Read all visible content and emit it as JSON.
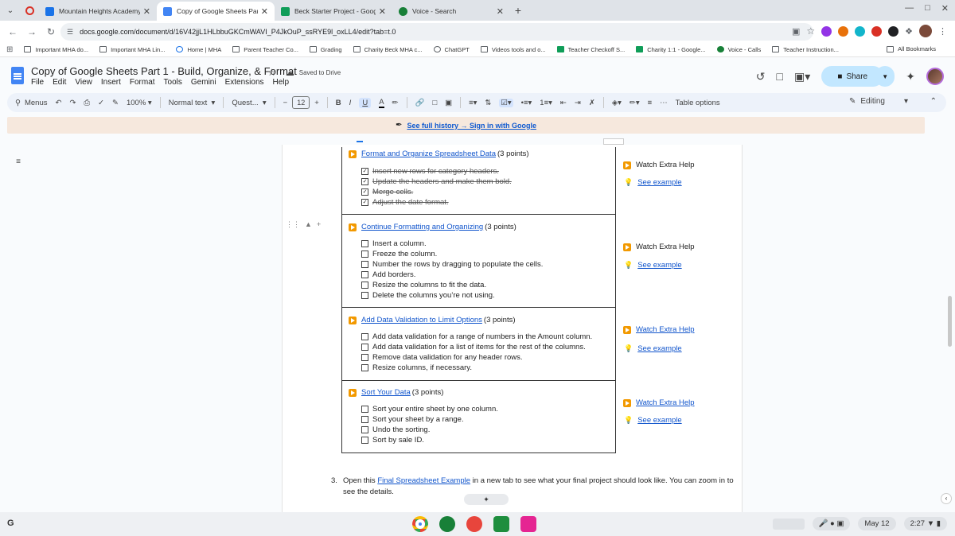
{
  "browser": {
    "tabs": [
      {
        "title": "Mountain Heights Academy - C",
        "color": "#1a73e8",
        "active": false
      },
      {
        "title": "Copy of Google Sheets Part 1 -",
        "color": "#4285f4",
        "active": true
      },
      {
        "title": "Beck Starter Project - Google Sh",
        "color": "#0f9d58",
        "active": false
      },
      {
        "title": "Voice - Search",
        "color": "#188038",
        "active": false
      }
    ],
    "url": "docs.google.com/document/d/16V42jjL1HLbbuGKCmWAVI_P4JkOuP_ssRYE9l_oxLL4/edit?tab=t.0",
    "bookmarks": [
      {
        "label": "Important MHA do...",
        "type": "folder"
      },
      {
        "label": "Important MHA Lin...",
        "type": "folder"
      },
      {
        "label": "Home | MHA",
        "type": "site"
      },
      {
        "label": "Parent Teacher Co...",
        "type": "folder"
      },
      {
        "label": "Grading",
        "type": "folder"
      },
      {
        "label": "Charity Beck MHA c...",
        "type": "folder"
      },
      {
        "label": "ChatGPT",
        "type": "site"
      },
      {
        "label": "Videos tools and o...",
        "type": "folder"
      },
      {
        "label": "Teacher Checkoff S...",
        "type": "sheet"
      },
      {
        "label": "Charity 1:1 - Google...",
        "type": "sheet"
      },
      {
        "label": "Voice - Calls",
        "type": "voice"
      },
      {
        "label": "Teacher Instruction...",
        "type": "folder"
      }
    ],
    "all_bookmarks": "All Bookmarks"
  },
  "doc": {
    "title": "Copy of Google Sheets Part 1 - Build, Organize, & Format",
    "saved": "Saved to Drive",
    "menu": [
      "File",
      "Edit",
      "View",
      "Insert",
      "Format",
      "Tools",
      "Gemini",
      "Extensions",
      "Help"
    ],
    "share": "Share"
  },
  "toolbar": {
    "menus": "Menus",
    "zoom": "100%",
    "style": "Normal text",
    "font": "Quest...",
    "size": "12",
    "bold": "B",
    "italic": "I",
    "underline": "U",
    "text_color": "A",
    "table_options": "Table options",
    "mode": "Editing"
  },
  "banner": {
    "text": "See full history → Sign in with Google"
  },
  "sections": [
    {
      "title": "Format and Organize Spreadsheet Data",
      "points": "(3 points)",
      "items": [
        {
          "text": "Insert new rows for category headers.",
          "done": true
        },
        {
          "text": "Update the headers and make them bold.",
          "done": true
        },
        {
          "text": "Merge cells.",
          "done": true
        },
        {
          "text": "Adjust the date format.",
          "done": true
        }
      ],
      "help": "Watch Extra Help",
      "example": "See example"
    },
    {
      "title": "Continue Formatting and Organizing",
      "points": "(3 points)",
      "items": [
        {
          "text": "Insert a column.",
          "done": false
        },
        {
          "text": "Freeze the column.",
          "done": false
        },
        {
          "text": "Number the rows by dragging to populate the cells.",
          "done": false
        },
        {
          "text": "Add borders.",
          "done": false
        },
        {
          "text": "Resize the columns to fit the data.",
          "done": false
        },
        {
          "text": "Delete the columns you’re not using.",
          "done": false
        }
      ],
      "help": "Watch Extra Help",
      "example": "See example"
    },
    {
      "title": "Add Data Validation to Limit Options",
      "points": "(3 points)",
      "items": [
        {
          "text": "Add data validation for a range of numbers in the Amount column.",
          "done": false
        },
        {
          "text": "Add data validation for a list of items for the rest of the columns.",
          "done": false
        },
        {
          "text": "Remove data validation for any header rows.",
          "done": false
        },
        {
          "text": "Resize columns, if necessary.",
          "done": false
        }
      ],
      "help": "Watch Extra Help",
      "example": "See example"
    },
    {
      "title": "Sort Your Data",
      "points": "(3 points)",
      "items": [
        {
          "text": "Sort your entire sheet by one column.",
          "done": false
        },
        {
          "text": "Sort your sheet by a range.",
          "done": false
        },
        {
          "text": "Undo the sorting.",
          "done": false
        },
        {
          "text": "Sort by sale ID.",
          "done": false
        }
      ],
      "help": "Watch Extra Help",
      "example": "See example"
    }
  ],
  "step3": {
    "num": "3.",
    "before": "Open this ",
    "link": "Final Spreadsheet Example",
    "after": " in a new tab to see what your final project should look like. You can zoom in to see the details."
  },
  "taskbar": {
    "date": "May 12",
    "time": "2:27"
  },
  "colors": {
    "accent": "#0b57d0",
    "share_bg": "#c2e7ff",
    "play_icon": "#f29900",
    "link": "#1155cc",
    "banner_bg": "#f6e8dd"
  }
}
